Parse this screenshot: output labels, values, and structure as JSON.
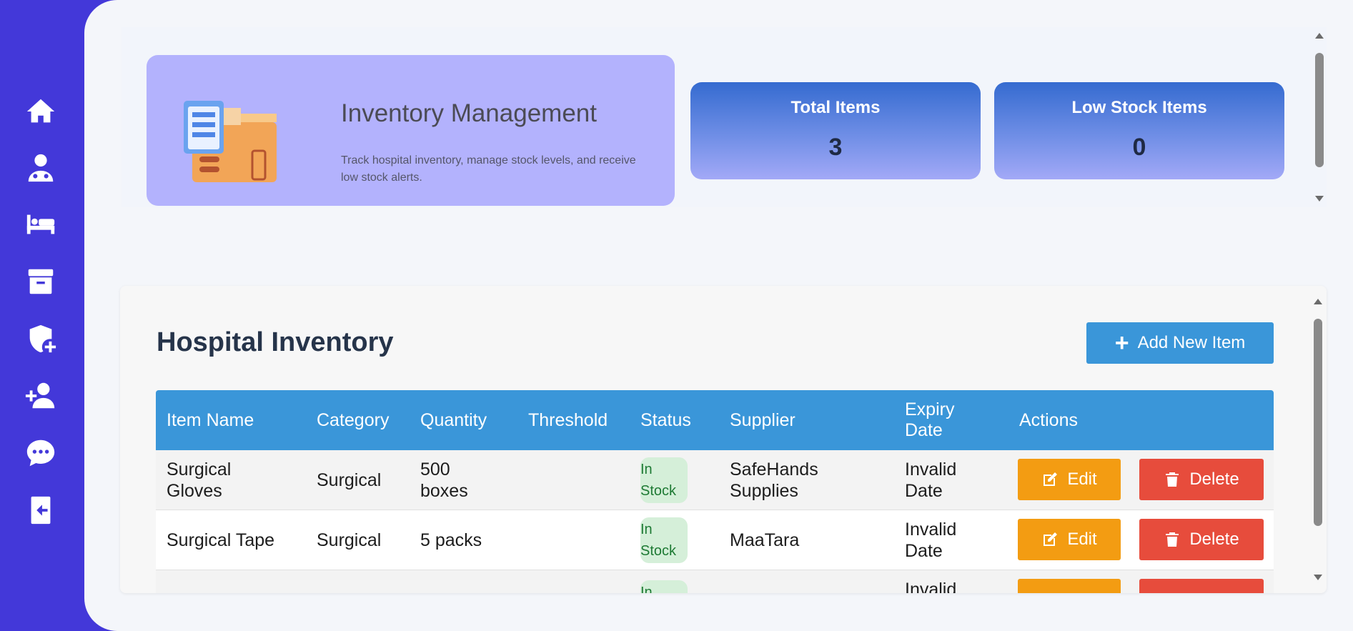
{
  "sidebar": {
    "items": [
      {
        "icon": "home-icon"
      },
      {
        "icon": "doctor-icon"
      },
      {
        "icon": "bed-icon"
      },
      {
        "icon": "archive-icon"
      },
      {
        "icon": "shield-plus-icon"
      },
      {
        "icon": "add-user-icon"
      },
      {
        "icon": "chat-icon"
      },
      {
        "icon": "logout-icon"
      }
    ]
  },
  "hero": {
    "title": "Inventory Management",
    "description": "Track hospital inventory, manage stock levels, and receive low stock alerts."
  },
  "stats": {
    "total": {
      "label": "Total Items",
      "value": "3"
    },
    "low": {
      "label": "Low Stock Items",
      "value": "0"
    }
  },
  "inventory": {
    "title": "Hospital Inventory",
    "add_label": "Add New Item",
    "columns": [
      "Item Name",
      "Category",
      "Quantity",
      "Threshold",
      "Status",
      "Supplier",
      "Expiry Date",
      "Actions"
    ],
    "rows": [
      {
        "name": "Surgical Gloves",
        "category": "Surgical",
        "quantity": "500 boxes",
        "threshold": "",
        "status": "In Stock",
        "supplier": "SafeHands Supplies",
        "expiry": "Invalid Date"
      },
      {
        "name": "Surgical Tape",
        "category": "Surgical",
        "quantity": "5 packs",
        "threshold": "",
        "status": "In Stock",
        "supplier": "MaaTara",
        "expiry": "Invalid Date"
      },
      {
        "name": "",
        "category": "",
        "quantity": "",
        "threshold": "",
        "status": "In",
        "supplier": "",
        "expiry": "Invalid"
      }
    ],
    "edit_label": "Edit",
    "delete_label": "Delete"
  },
  "colors": {
    "sidebar": "#4338d9",
    "hero": "#b3b2fd",
    "table_header": "#3a96d9",
    "edit": "#f39c12",
    "delete": "#e74c3c"
  }
}
